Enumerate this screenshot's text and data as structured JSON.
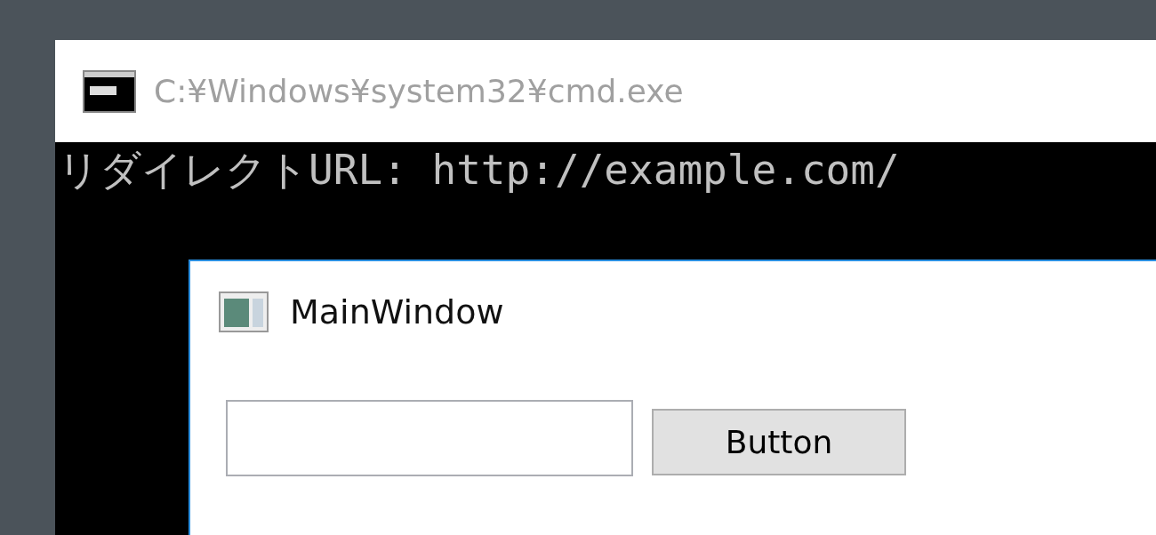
{
  "console_window": {
    "title": "C:¥Windows¥system32¥cmd.exe",
    "lines": [
      "リダイレクトURL: http://example.com/"
    ]
  },
  "main_window": {
    "title": "MainWindow",
    "button": {
      "label": "Button"
    }
  }
}
